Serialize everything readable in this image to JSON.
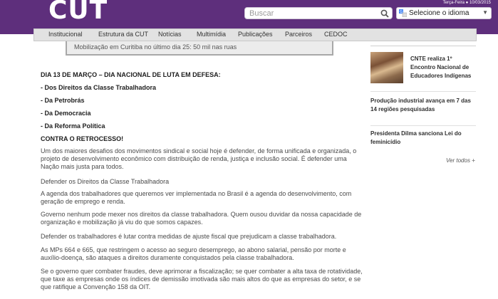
{
  "header": {
    "logo": "CUT",
    "date": "Terça-Feira ● 10/03/2015",
    "colors": {
      "brand": "#5e2f7c"
    }
  },
  "search": {
    "placeholder": "Buscar",
    "icon": "search-icon"
  },
  "language": {
    "label": "Selecione o idioma",
    "icon": "google-translate-icon"
  },
  "nav": {
    "items": [
      "Institucional",
      "Estrutura da CUT",
      "Notícias",
      "Multimídia",
      "Publicações",
      "Parceiros",
      "CEDOC"
    ]
  },
  "photo_caption": "Mobilização em Curitiba no último dia 25: 50 mil nas ruas",
  "article": {
    "lines": [
      "DIA 13 DE MARÇO – DIA NACIONAL DE LUTA EM DEFESA:",
      "- Dos Direitos da Classe Trabalhadora",
      "- Da Petrobrás",
      "- Da Democracia",
      "- Da Reforma Política",
      "CONTRA O RETROCESSO!"
    ],
    "paragraphs": [
      "Um dos maiores desafios dos movimentos sindical e social hoje é defender, de forma unificada e organizada, o projeto de desenvolvimento econômico com distribuição de renda, justiça e inclusão social. É defender uma Nação mais justa para todos.",
      "Defender os Direitos da Classe Trabalhadora",
      "A agenda dos trabalhadores que queremos ver implementada no Brasil é a agenda do desenvolvimento, com geração de emprego e renda.",
      "Governo nenhum pode mexer nos direitos da classe trabalhadora. Quem ousou duvidar da nossa capacidade de organização e mobilização já viu do que somos capazes.",
      "Defender os trabalhadores é lutar contra medidas de ajuste fiscal que prejudicam a classe trabalhadora.",
      "As MPs 664 e 665, que restringem o acesso ao seguro desemprego, ao abono salarial, pensão por morte e auxílio-doença, são ataques a direitos duramente conquistados pela classe trabalhadora.",
      "Se o governo quer combater fraudes, deve aprimorar a fiscalização; se quer combater a alta taxa de rotatividade, que taxe as empresas onde os índices de demissão imotivada são mais altos do que as empresas do setor, e se que ratifique a Convenção 158 da OIT."
    ]
  },
  "sidebar": {
    "news": [
      "CNTE realiza 1º Encontro Nacional de Educadores Indígenas",
      "Produção industrial avança em 7 das 14 regiões pesquisadas",
      "Presidenta Dilma sanciona Lei do feminicídio"
    ],
    "see_all": "Ver todos"
  }
}
